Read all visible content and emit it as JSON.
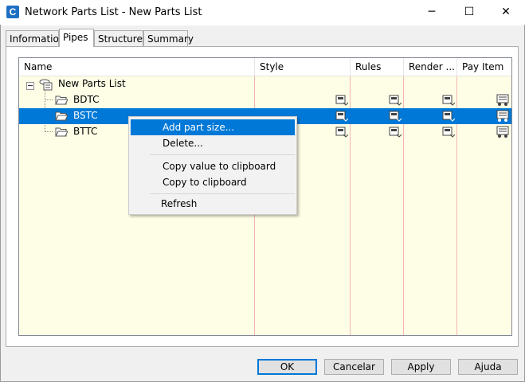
{
  "window": {
    "title": "Network Parts List - New Parts List",
    "app_icon_letter": "C",
    "minimize": "─",
    "maximize": "☐",
    "close": "✕"
  },
  "tabs": [
    {
      "label": "Information",
      "active": false
    },
    {
      "label": "Pipes",
      "active": true
    },
    {
      "label": "Structures",
      "active": false
    },
    {
      "label": "Summary",
      "active": false
    }
  ],
  "grid": {
    "columns": [
      "Name",
      "Style",
      "Rules",
      "Render ...",
      "Pay Item"
    ],
    "root": "New Parts List",
    "rows": [
      {
        "name": "BDTC",
        "selected": false
      },
      {
        "name": "BSTC",
        "selected": true
      },
      {
        "name": "BTTC",
        "selected": false
      }
    ]
  },
  "context_menu": {
    "items": [
      {
        "label": "Add part size...",
        "highlighted": true
      },
      {
        "label": "Delete..."
      },
      {
        "label": "Copy value to clipboard"
      },
      {
        "label": "Copy to clipboard"
      },
      {
        "label": "Refresh"
      }
    ]
  },
  "buttons": {
    "ok": "OK",
    "cancel": "Cancelar",
    "apply": "Apply",
    "help": "Ajuda"
  },
  "colors": {
    "selection": "#0078d7",
    "grid_background": "#fefee6",
    "column_divider": "#f2b5b5"
  }
}
